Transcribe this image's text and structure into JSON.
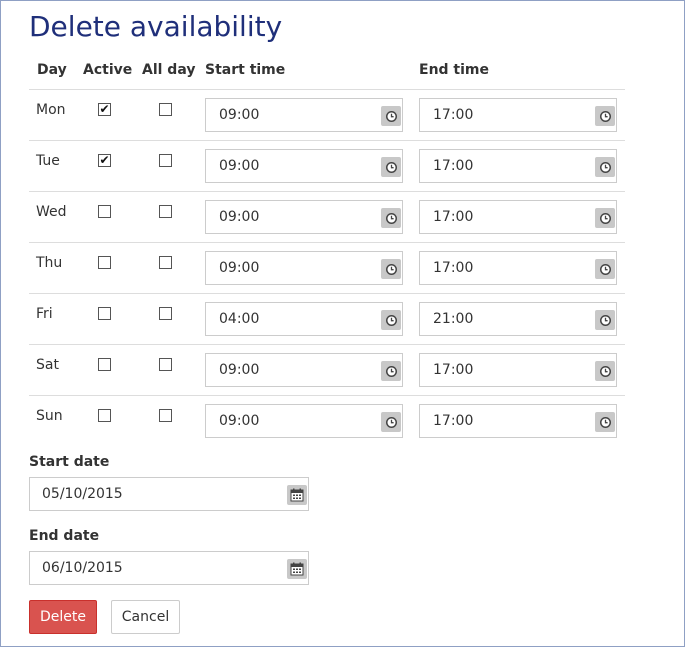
{
  "page": {
    "title": "Delete availability"
  },
  "headers": {
    "day": "Day",
    "active": "Active",
    "all_day": "All day",
    "start_time": "Start time",
    "end_time": "End time"
  },
  "rows": [
    {
      "day": "Mon",
      "active": true,
      "all_day": false,
      "start": "09:00",
      "end": "17:00"
    },
    {
      "day": "Tue",
      "active": true,
      "all_day": false,
      "start": "09:00",
      "end": "17:00"
    },
    {
      "day": "Wed",
      "active": false,
      "all_day": false,
      "start": "09:00",
      "end": "17:00"
    },
    {
      "day": "Thu",
      "active": false,
      "all_day": false,
      "start": "09:00",
      "end": "17:00"
    },
    {
      "day": "Fri",
      "active": false,
      "all_day": false,
      "start": "04:00",
      "end": "21:00"
    },
    {
      "day": "Sat",
      "active": false,
      "all_day": false,
      "start": "09:00",
      "end": "17:00"
    },
    {
      "day": "Sun",
      "active": false,
      "all_day": false,
      "start": "09:00",
      "end": "17:00"
    }
  ],
  "start_date": {
    "label": "Start date",
    "value": "05/10/2015"
  },
  "end_date": {
    "label": "End date",
    "value": "06/10/2015"
  },
  "buttons": {
    "delete": "Delete",
    "cancel": "Cancel"
  },
  "icons": {
    "time": "clock-icon",
    "date": "calendar-icon",
    "check": "checkmark-icon"
  },
  "colors": {
    "title": "#1f2f7a",
    "delete_button": "#d9534f",
    "icon_bg": "#c8c8c8"
  }
}
